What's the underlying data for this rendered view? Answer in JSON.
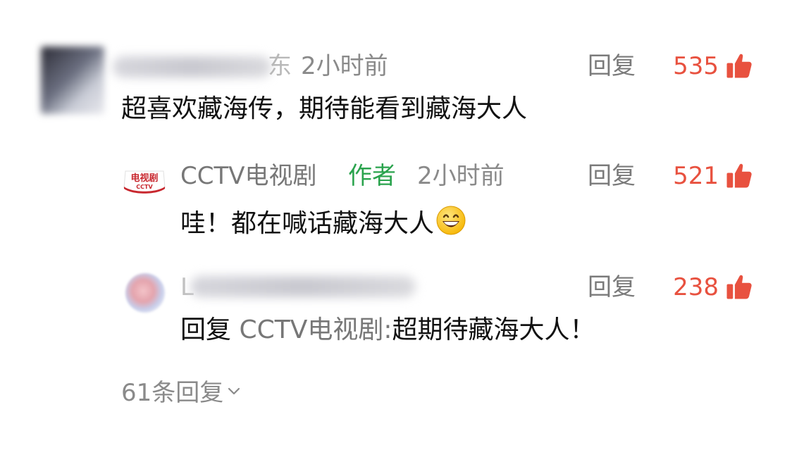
{
  "comments": [
    {
      "name_visible_suffix": "东",
      "time": "2小时前",
      "reply_label": "回复",
      "likes": "535",
      "text": "超喜欢藏海传，期待能看到藏海大人"
    },
    {
      "name": "CCTV电视剧",
      "author_badge": "作者",
      "time": "2小时前",
      "reply_label": "回复",
      "likes": "521",
      "text": "哇！都在喊话藏海大人",
      "avatar_text_top": "电视剧",
      "avatar_text_bottom": "CCTV"
    },
    {
      "name_visible_prefix": "L",
      "reply_label": "回复",
      "likes": "238",
      "reply_prefix": "回复",
      "reply_target": "CCTV电视剧:",
      "text": "超期待藏海大人！"
    }
  ],
  "more_replies": "61条回复",
  "colors": {
    "like_red": "#e8513f",
    "author_green": "#2aa34d",
    "meta_gray": "#8a8a8a"
  },
  "icons": {
    "like": "thumbs-up-icon",
    "emoji": "grinning-face-icon",
    "expand": "chevron-down-icon"
  }
}
